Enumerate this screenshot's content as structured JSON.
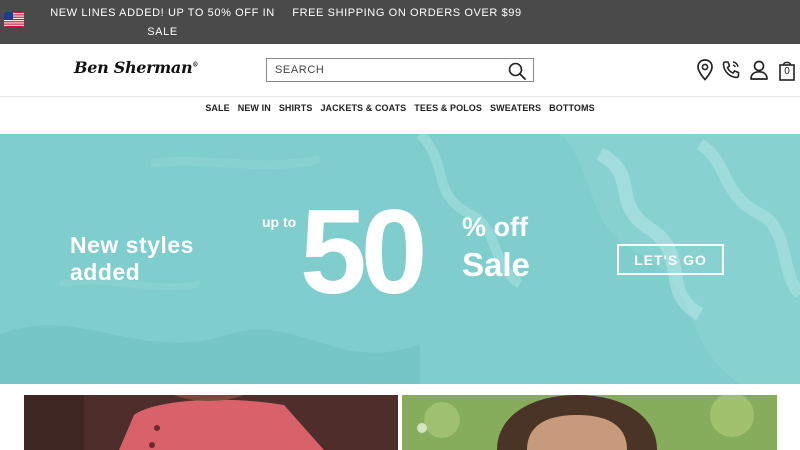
{
  "promo": {
    "locale_flag": "us-flag-icon",
    "message_left": "NEW LINES ADDED! UP TO 50% OFF IN SALE",
    "message_right": "FREE SHIPPING ON ORDERS OVER $99"
  },
  "header": {
    "logo_text": "Ben Sherman",
    "logo_mark": "®",
    "search": {
      "placeholder": "SEARCH",
      "value": ""
    },
    "icons": [
      "store-locator-icon",
      "phone-icon",
      "account-icon",
      "bag-icon"
    ],
    "bag_count": "0"
  },
  "nav": {
    "items": [
      {
        "label": "SALE"
      },
      {
        "label": "NEW IN"
      },
      {
        "label": "SHIRTS"
      },
      {
        "label": "JACKETS & COATS"
      },
      {
        "label": "TEES & POLOS"
      },
      {
        "label": "SWEATERS"
      },
      {
        "label": "BOTTOMS"
      }
    ]
  },
  "hero": {
    "headline_line1": "New styles",
    "headline_line2": "added",
    "up_to": "up to",
    "big_number": "50",
    "percent_off": "% off",
    "sale": "Sale",
    "cta": "LET'S GO",
    "bg_color": "#7fcdcc"
  },
  "colors": {
    "promo_bg": "#4a4a4a",
    "hero_bg": "#7fcdcc",
    "text_dark": "#222222"
  }
}
